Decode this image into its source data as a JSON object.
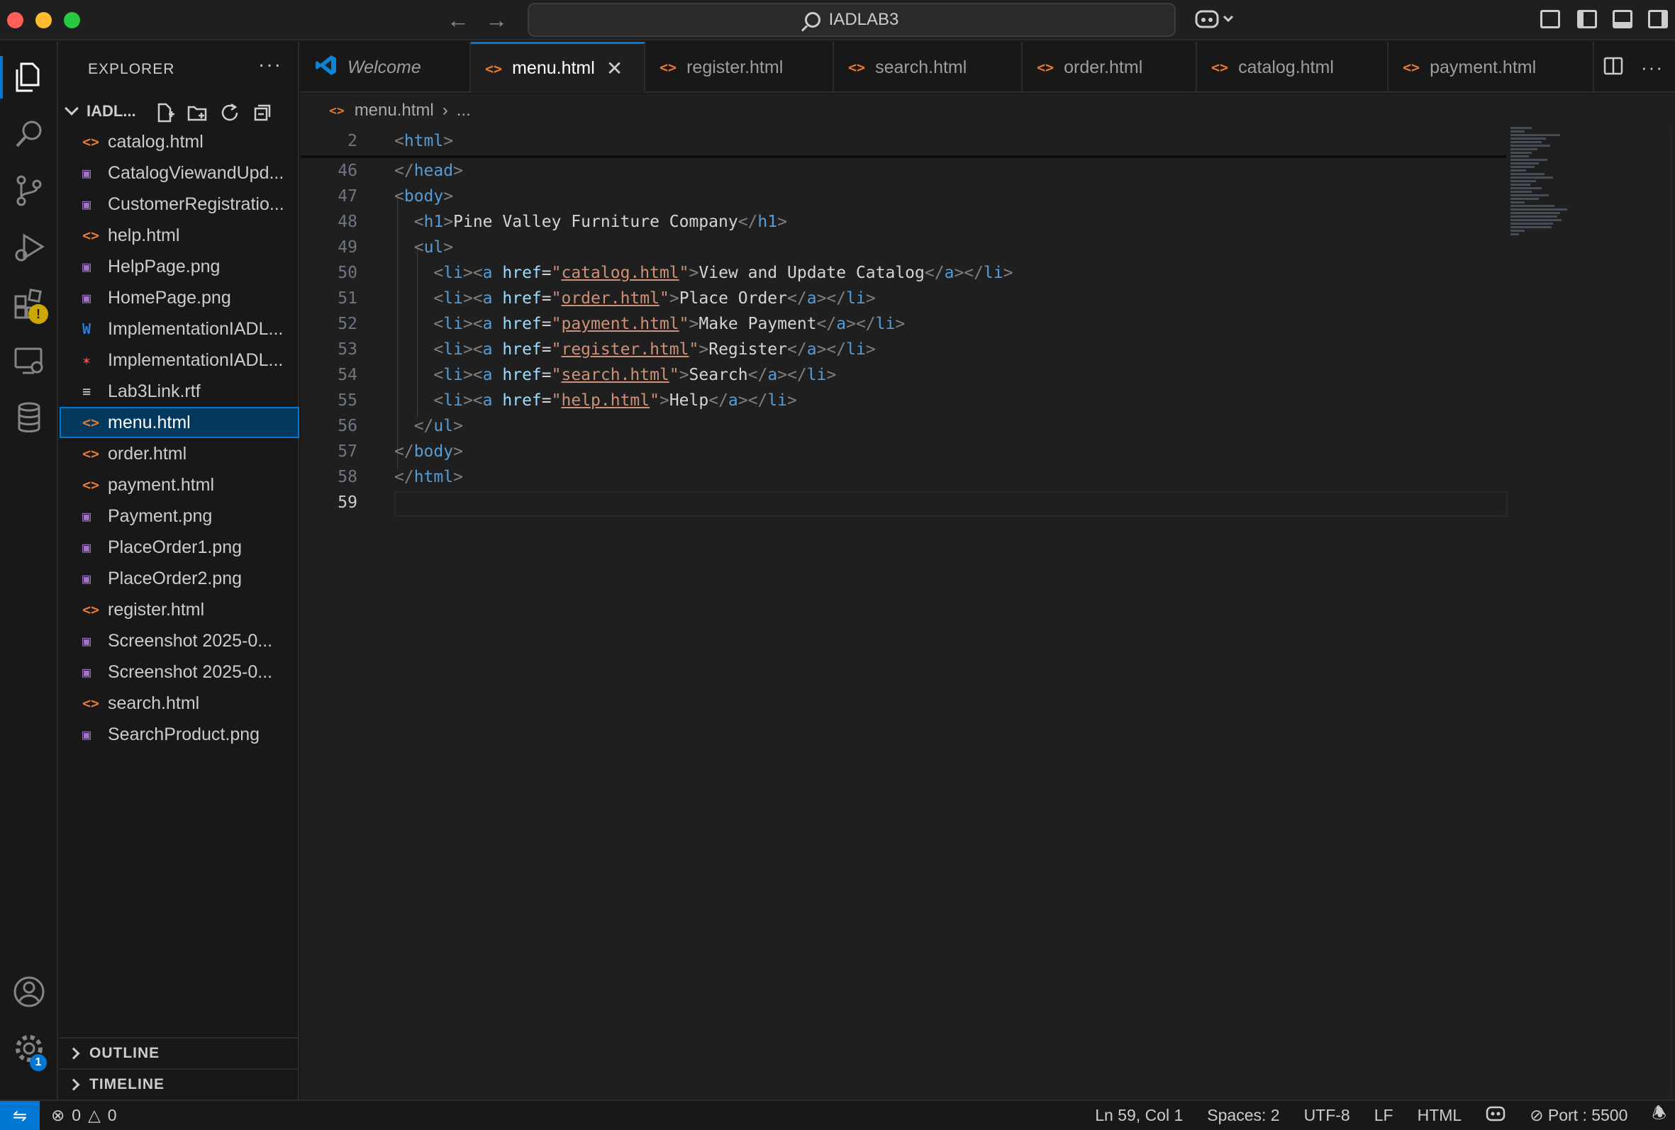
{
  "window": {
    "title": "IADLAB3"
  },
  "sidebar": {
    "header": "EXPLORER",
    "more": "···",
    "folder": "IADL...",
    "files": [
      {
        "name": "catalog.html",
        "type": "html"
      },
      {
        "name": "CatalogViewandUpd...",
        "type": "png"
      },
      {
        "name": "CustomerRegistratio...",
        "type": "png"
      },
      {
        "name": "help.html",
        "type": "html"
      },
      {
        "name": "HelpPage.png",
        "type": "png"
      },
      {
        "name": "HomePage.png",
        "type": "png"
      },
      {
        "name": "ImplementationIADL...",
        "type": "docx"
      },
      {
        "name": "ImplementationIADL...",
        "type": "pdf"
      },
      {
        "name": "Lab3Link.rtf",
        "type": "rtf"
      },
      {
        "name": "menu.html",
        "type": "html"
      },
      {
        "name": "order.html",
        "type": "html"
      },
      {
        "name": "payment.html",
        "type": "html"
      },
      {
        "name": "Payment.png",
        "type": "png"
      },
      {
        "name": "PlaceOrder1.png",
        "type": "png"
      },
      {
        "name": "PlaceOrder2.png",
        "type": "png"
      },
      {
        "name": "register.html",
        "type": "html"
      },
      {
        "name": "Screenshot 2025-0...",
        "type": "png"
      },
      {
        "name": "Screenshot 2025-0...",
        "type": "png"
      },
      {
        "name": "search.html",
        "type": "html"
      },
      {
        "name": "SearchProduct.png",
        "type": "png"
      }
    ],
    "outline": "OUTLINE",
    "timeline": "TIMELINE"
  },
  "tabs": [
    {
      "label": "Welcome"
    },
    {
      "label": "menu.html"
    },
    {
      "label": "register.html"
    },
    {
      "label": "search.html"
    },
    {
      "label": "order.html"
    },
    {
      "label": "catalog.html"
    },
    {
      "label": "payment.html"
    }
  ],
  "breadcrumb": {
    "file": "menu.html",
    "rest": "..."
  },
  "editor": {
    "lines": [
      {
        "n": "2",
        "text": "<html>"
      },
      {
        "n": "46",
        "text": "</head>"
      },
      {
        "n": "47",
        "text": "<body>"
      },
      {
        "n": "48",
        "text": "  <h1>Pine Valley Furniture Company</h1>"
      },
      {
        "n": "49",
        "text": "  <ul>"
      },
      {
        "n": "50",
        "text": "    <li><a href=\"catalog.html\">View and Update Catalog</a></li>"
      },
      {
        "n": "51",
        "text": "    <li><a href=\"order.html\">Place Order</a></li>"
      },
      {
        "n": "52",
        "text": "    <li><a href=\"payment.html\">Make Payment</a></li>"
      },
      {
        "n": "53",
        "text": "    <li><a href=\"register.html\">Register</a></li>"
      },
      {
        "n": "54",
        "text": "    <li><a href=\"search.html\">Search</a></li>"
      },
      {
        "n": "55",
        "text": "    <li><a href=\"help.html\">Help</a></li>"
      },
      {
        "n": "56",
        "text": "  </ul>"
      },
      {
        "n": "57",
        "text": "</body>"
      },
      {
        "n": "58",
        "text": "</html>"
      },
      {
        "n": "59",
        "text": ""
      }
    ],
    "h1_text": "Pine Valley Furniture Company",
    "links": [
      {
        "href": "catalog.html",
        "text": "View and Update Catalog"
      },
      {
        "href": "order.html",
        "text": "Place Order"
      },
      {
        "href": "payment.html",
        "text": "Make Payment"
      },
      {
        "href": "register.html",
        "text": "Register"
      },
      {
        "href": "search.html",
        "text": "Search"
      },
      {
        "href": "help.html",
        "text": "Help"
      }
    ]
  },
  "activity": {
    "accounts_badge": "",
    "manage_badge": "1",
    "extensions_warning": "!"
  },
  "status": {
    "errors": "0",
    "warnings": "0",
    "position": "Ln 59, Col 1",
    "spaces": "Spaces: 2",
    "encoding": "UTF-8",
    "eol": "LF",
    "language": "HTML",
    "port": "Port : 5500"
  },
  "colors": {
    "accent": "#0078d4",
    "html_icon": "#e37933",
    "tag": "#569cd6",
    "string": "#ce9178",
    "attribute": "#9cdcfe"
  }
}
